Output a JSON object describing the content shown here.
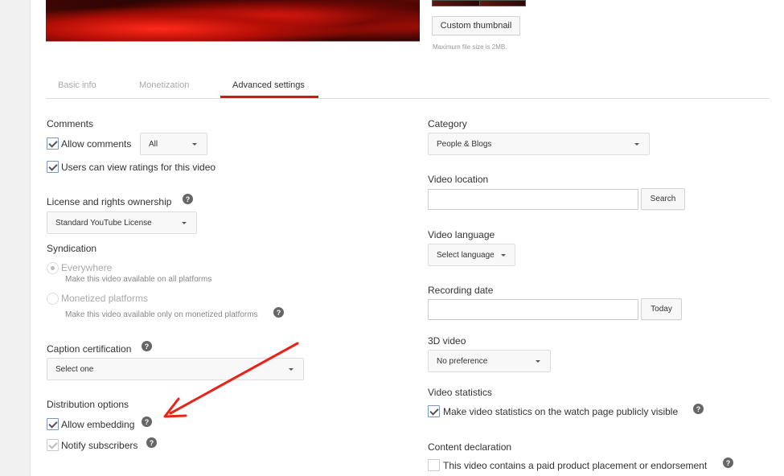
{
  "thumbnail": {
    "custom_button": "Custom thumbnail",
    "max_size_hint": "Maximum file size is 2MB."
  },
  "tabs": [
    {
      "label": "Basic info",
      "active": false
    },
    {
      "label": "Monetization",
      "active": false
    },
    {
      "label": "Advanced settings",
      "active": true
    }
  ],
  "accent_color": "#cc181e",
  "left": {
    "comments": {
      "heading": "Comments",
      "allow_comments": {
        "label": "Allow comments",
        "checked": true
      },
      "comments_filter": {
        "value": "All"
      },
      "view_ratings": {
        "label": "Users can view ratings for this video",
        "checked": true
      }
    },
    "license": {
      "heading": "License and rights ownership",
      "help_icon": "help-icon",
      "value": "Standard YouTube License"
    },
    "syndication": {
      "heading": "Syndication",
      "options": [
        {
          "label": "Everywhere",
          "description": "Make this video available on all platforms",
          "selected": true
        },
        {
          "label": "Monetized platforms",
          "description": "Make this video available only on monetized platforms",
          "selected": false
        }
      ]
    },
    "caption": {
      "heading": "Caption certification",
      "value": "Select one"
    },
    "distribution": {
      "heading": "Distribution options",
      "allow_embedding": {
        "label": "Allow embedding",
        "checked": true
      },
      "notify_subscribers": {
        "label": "Notify subscribers",
        "checked": true,
        "disabled": true
      }
    }
  },
  "right": {
    "category": {
      "heading": "Category",
      "value": "People & Blogs"
    },
    "location": {
      "heading": "Video location",
      "value": "",
      "search_button": "Search"
    },
    "language": {
      "heading": "Video language",
      "value": "Select language"
    },
    "recording_date": {
      "heading": "Recording date",
      "value": "",
      "today_button": "Today"
    },
    "video_3d": {
      "heading": "3D video",
      "value": "No preference"
    },
    "statistics": {
      "heading": "Video statistics",
      "label": "Make video statistics on the watch page publicly visible",
      "checked": true
    },
    "content_declaration": {
      "heading": "Content declaration",
      "label": "This video contains a paid product placement or endorsement",
      "checked": false
    }
  },
  "annotation": {
    "type": "arrow",
    "color": "#e8231a",
    "points_to": "Allow embedding"
  }
}
